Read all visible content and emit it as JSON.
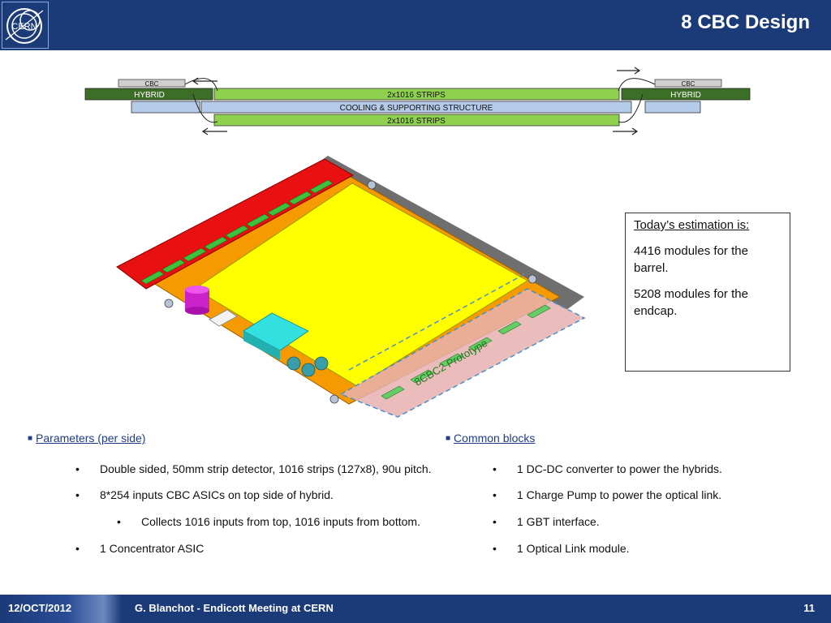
{
  "header": {
    "title": "8 CBC Design"
  },
  "logo": {
    "text": "CERN"
  },
  "cross_section": {
    "cbc_left": "CBC",
    "cbc_right": "CBC",
    "hybrid_left": "HYBRID",
    "hybrid_right": "HYBRID",
    "strips_top": "2x1016 STRIPS",
    "cooling": "COOLING & SUPPORTING STRUCTURE",
    "strips_bottom": "2x1016 STRIPS"
  },
  "prototype": {
    "label": "8CBC2 Prototype"
  },
  "estimation": {
    "heading": "Today’s estimation is:",
    "barrel": "4416 modules for the barrel.",
    "endcap": "5208 modules for the endcap."
  },
  "parameters": {
    "heading": "Parameters (per side)",
    "items": [
      "Double sided, 50mm strip detector, 1016 strips (127x8), 90u pitch.",
      "8*254 inputs CBC ASICs on top side of hybrid.",
      "Collects 1016 inputs from top, 1016 inputs from bottom.",
      "1 Concentrator ASIC"
    ]
  },
  "common_blocks": {
    "heading": "Common blocks",
    "items": [
      "1 DC-DC converter to power the hybrids.",
      "1 Charge Pump to power the optical link.",
      "1 GBT interface.",
      "1 Optical Link module."
    ]
  },
  "footer": {
    "date": "12/OCT/2012",
    "center": "G. Blanchot - Endicott Meeting at CERN",
    "page": "11"
  },
  "colors": {
    "header_bg": "#1b3a78",
    "hybrid_green": "#3c6e28",
    "strip_green": "#8fd14f",
    "cooling_blue": "#b4cce9",
    "board_red": "#e81010",
    "sensor_yellow": "#ffff00",
    "board_orange": "#f59a00"
  }
}
